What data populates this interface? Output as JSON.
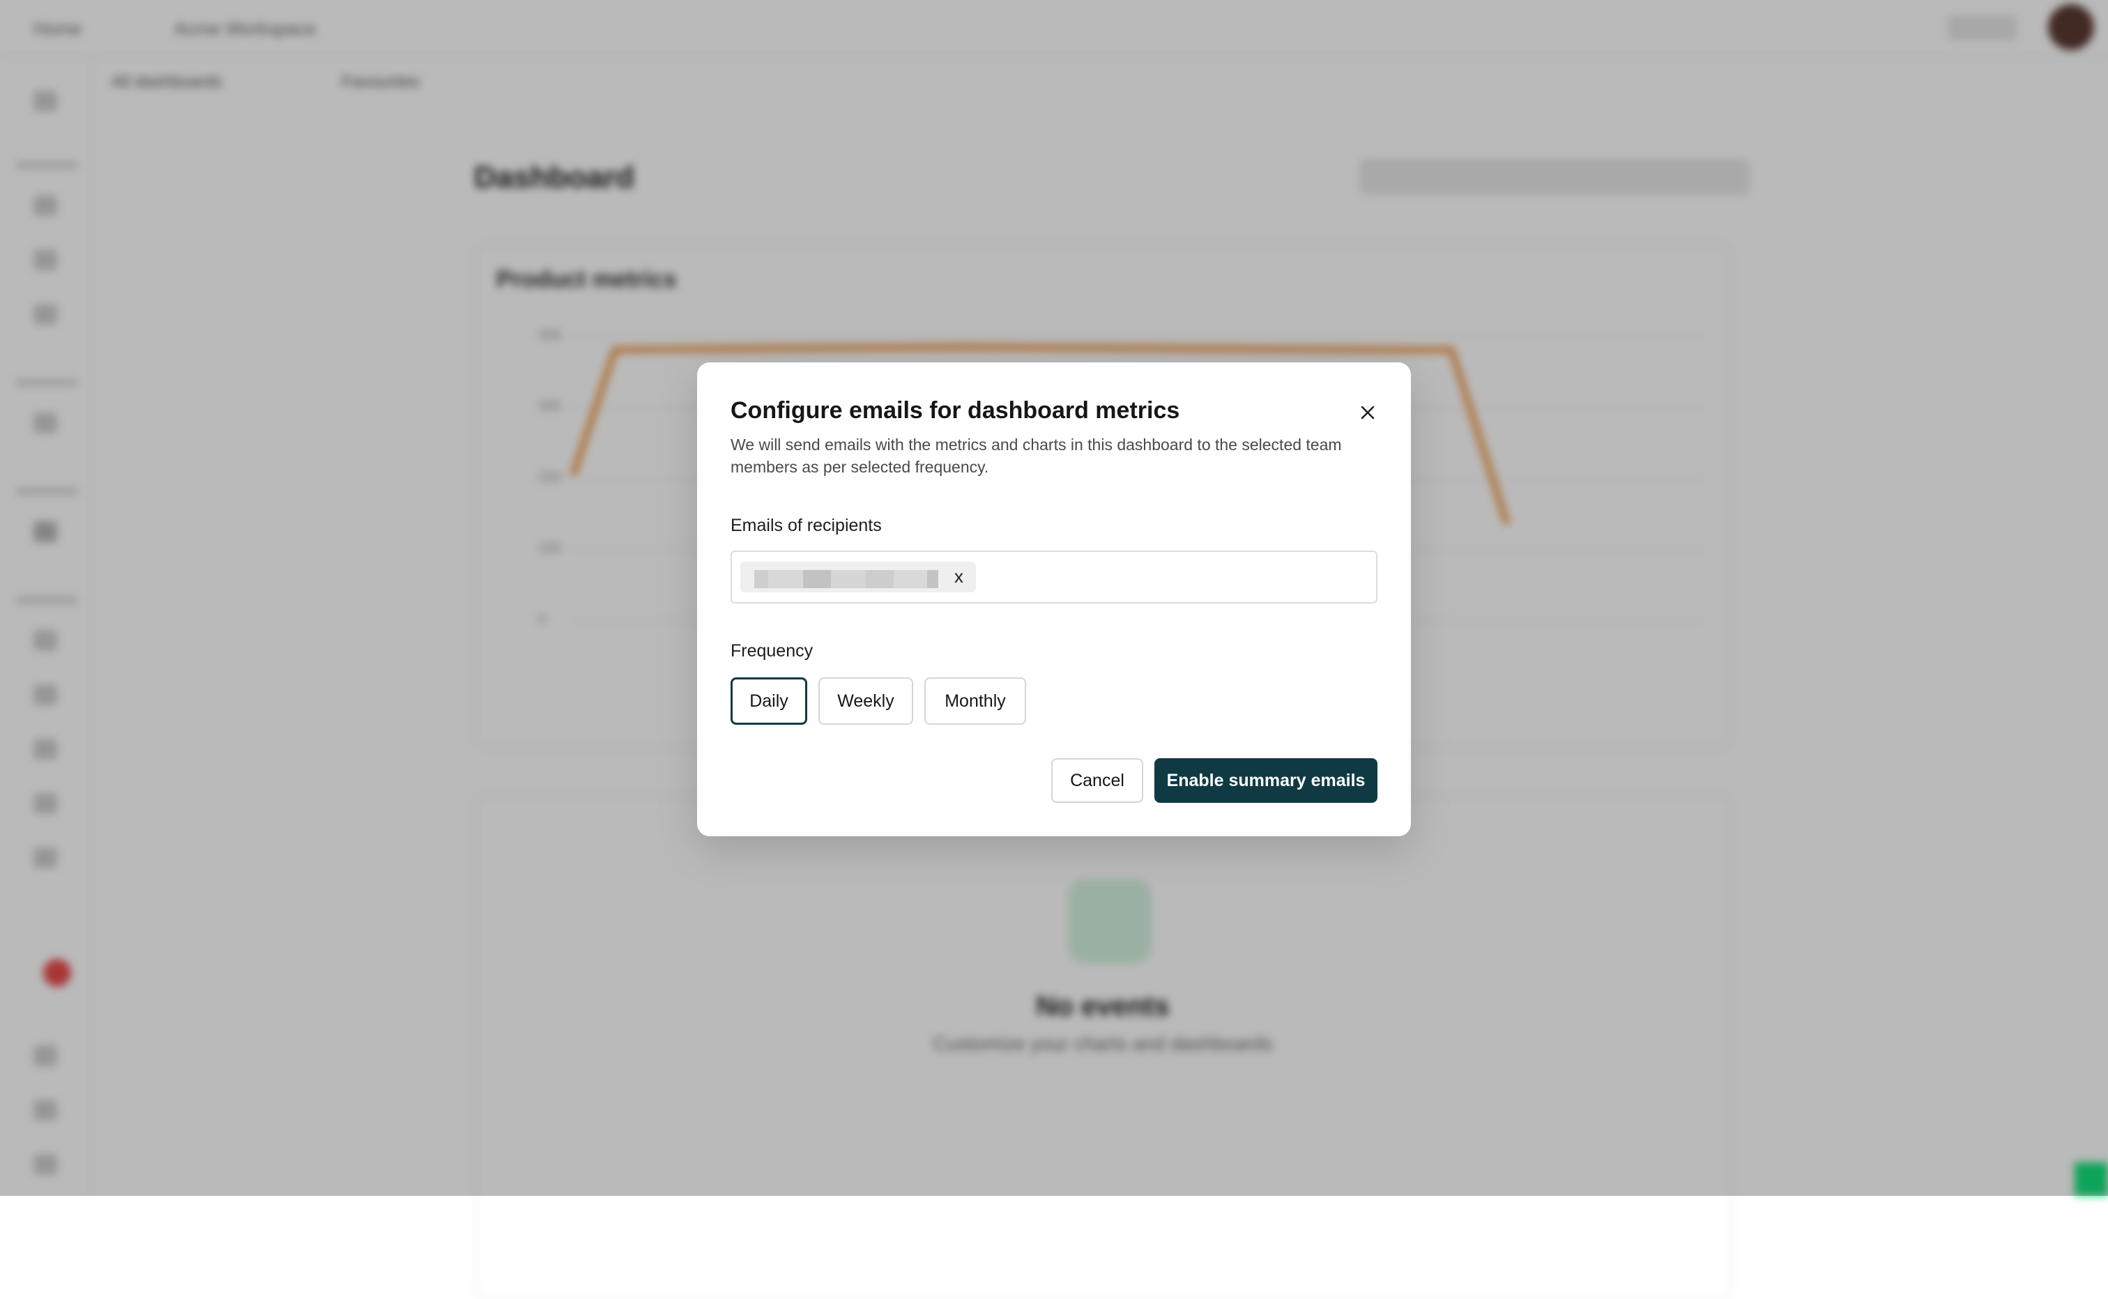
{
  "background": {
    "topbar": {
      "crumb_left": "Home",
      "crumb_project": "Acme Workspace"
    },
    "tabs": [
      "All dashboards",
      "Favourites"
    ],
    "page_title": "Dashboard",
    "card_title": "Product metrics",
    "empty_state": {
      "title": "No events",
      "subtitle": "Customize your charts and dashboards"
    },
    "y_ticks": [
      "400",
      "300",
      "200",
      "100",
      "0"
    ]
  },
  "modal": {
    "title": "Configure emails for dashboard metrics",
    "description": "We will send emails with the metrics and charts in this dashboard to the selected team members as per selected frequency.",
    "recipients_label": "Emails of recipients",
    "chip_remove": "x",
    "frequency_label": "Frequency",
    "frequency_options": [
      "Daily",
      "Weekly",
      "Monthly"
    ],
    "selected_frequency": "Daily",
    "cancel_label": "Cancel",
    "submit_label": "Enable summary emails"
  },
  "colors": {
    "primary": "#0f3a44",
    "overlay": "rgba(0,0,0,0.27)",
    "accent_green": "#13e07a",
    "chart_line": "#f0a15a"
  },
  "icons": {
    "close": "close-icon"
  }
}
